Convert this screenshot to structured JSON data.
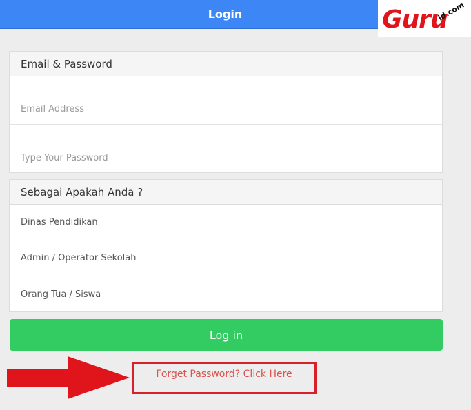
{
  "header": {
    "title": "Login"
  },
  "logo": {
    "word": "Guru",
    "domain": "id.com"
  },
  "credentials": {
    "heading": "Email & Password",
    "email_placeholder": "Email Address",
    "password_placeholder": "Type Your Password"
  },
  "role": {
    "heading": "Sebagai Apakah Anda ?",
    "options": [
      {
        "label": "Dinas Pendidikan"
      },
      {
        "label": "Admin / Operator Sekolah"
      },
      {
        "label": "Orang Tua / Siswa"
      }
    ]
  },
  "actions": {
    "login_label": "Log in",
    "forget_label": "Forget Password? Click Here"
  },
  "colors": {
    "header": "#3d86f5",
    "login_button": "#33cc63",
    "annotation": "#d8202a",
    "link": "#d9534f"
  },
  "icons": {
    "annotation_arrow": "red-arrow-icon"
  }
}
